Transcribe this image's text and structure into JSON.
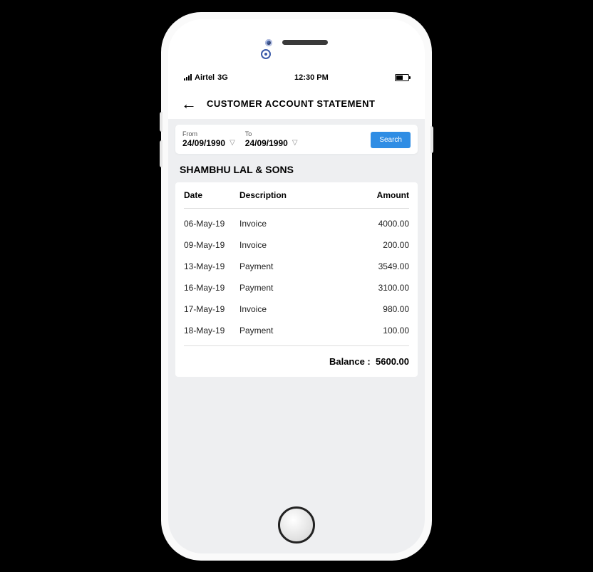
{
  "status_bar": {
    "carrier": "Airtel",
    "network": "3G",
    "time": "12:30 PM"
  },
  "header": {
    "title": "CUSTOMER ACCOUNT STATEMENT"
  },
  "filter": {
    "from_label": "From",
    "from_value": "24/09/1990",
    "to_label": "To",
    "to_value": "24/09/1990",
    "search_label": "Search"
  },
  "customer": {
    "name": "SHAMBHU LAL & SONS"
  },
  "table": {
    "col_date": "Date",
    "col_description": "Description",
    "col_amount": "Amount",
    "rows": [
      {
        "date": "06-May-19",
        "description": "Invoice",
        "amount": "4000.00"
      },
      {
        "date": "09-May-19",
        "description": "Invoice",
        "amount": "200.00"
      },
      {
        "date": "13-May-19",
        "description": "Payment",
        "amount": "3549.00"
      },
      {
        "date": "16-May-19",
        "description": "Payment",
        "amount": "3100.00"
      },
      {
        "date": "17-May-19",
        "description": "Invoice",
        "amount": "980.00"
      },
      {
        "date": "18-May-19",
        "description": "Payment",
        "amount": "100.00"
      }
    ]
  },
  "balance": {
    "label": "Balance  :",
    "value": "5600.00"
  }
}
